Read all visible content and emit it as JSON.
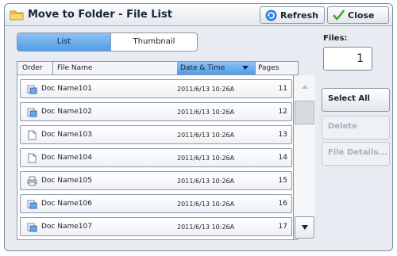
{
  "window": {
    "title": "Move to Folder - File List"
  },
  "toolbar": {
    "refresh_label": "Refresh",
    "close_label": "Close"
  },
  "tabs": [
    {
      "label": "List",
      "selected": true
    },
    {
      "label": "Thumbnail",
      "selected": false
    }
  ],
  "files": {
    "label": "Files:",
    "value": "1"
  },
  "table": {
    "columns": [
      "Order",
      "File Name",
      "Date & Time",
      "Pages"
    ],
    "sorted_column": "Date & Time",
    "rows": [
      {
        "icon": "scan-doc-icon",
        "name": "Doc Name101",
        "datetime": "2011/6/13 10:26A",
        "pages": "11"
      },
      {
        "icon": "scan-doc-icon",
        "name": "Doc Name102",
        "datetime": "2011/6/13 10:26A",
        "pages": "12"
      },
      {
        "icon": "doc-page-icon",
        "name": "Doc Name103",
        "datetime": "2011/6/13 10:26A",
        "pages": "13"
      },
      {
        "icon": "doc-page-icon",
        "name": "Doc Name104",
        "datetime": "2011/6/13 10:26A",
        "pages": "14"
      },
      {
        "icon": "printer-icon",
        "name": "Doc Name105",
        "datetime": "2011/6/13 10:26A",
        "pages": "15"
      },
      {
        "icon": "scan-doc-icon",
        "name": "Doc Name106",
        "datetime": "2011/6/13 10:26A",
        "pages": "16"
      },
      {
        "icon": "scan-doc-icon",
        "name": "Doc Name107",
        "datetime": "2011/6/13 10:26A",
        "pages": "17"
      }
    ]
  },
  "side_buttons": {
    "select_all": "Select All",
    "delete": "Delete",
    "file_details": "File Details..."
  },
  "colors": {
    "accent": "#4f9be6",
    "frame": "#8a98a8"
  }
}
